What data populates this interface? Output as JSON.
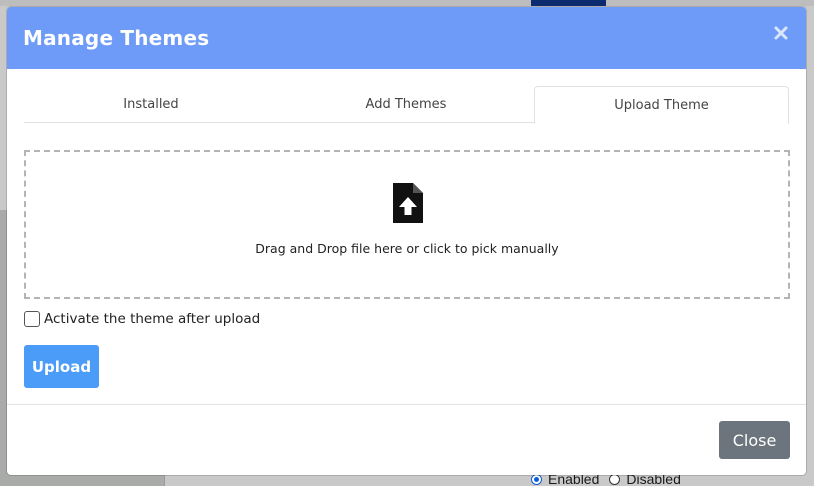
{
  "modal": {
    "title": "Manage Themes",
    "close_icon": "close-icon",
    "header_color": "#6d9bf7"
  },
  "tabs": [
    {
      "label": "Installed",
      "active": false
    },
    {
      "label": "Add Themes",
      "active": false
    },
    {
      "label": "Upload Theme",
      "active": true
    }
  ],
  "dropzone": {
    "icon": "file-upload-icon",
    "text": "Drag and Drop file here or click to pick manually"
  },
  "activate_checkbox": {
    "label": "Activate the theme after upload",
    "checked": false
  },
  "buttons": {
    "upload_label": "Upload",
    "upload_color": "#4a9cf8",
    "close_label": "Close",
    "close_color": "#6c757d"
  },
  "background": {
    "status_options": [
      {
        "label": "Enabled",
        "selected": true
      },
      {
        "label": "Disabled",
        "selected": false
      }
    ]
  }
}
